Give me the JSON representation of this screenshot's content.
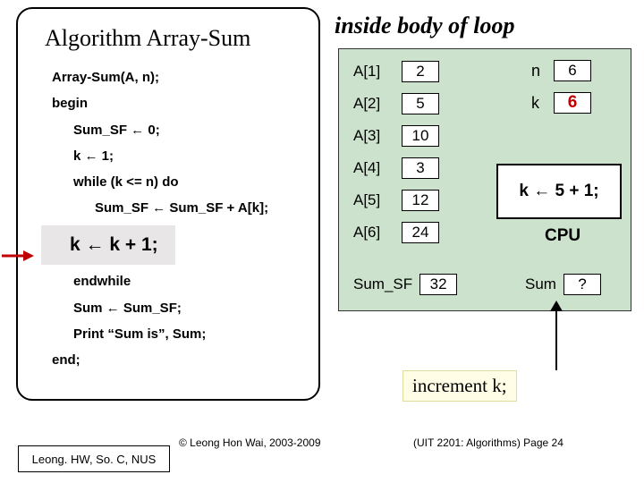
{
  "algo": {
    "title": "Algorithm Array-Sum",
    "l1": "Array-Sum(A, n);",
    "l2": "begin",
    "l3": "Sum_SF ← 0;",
    "l4": "k ← 1;",
    "l5": "while (k <= n) do",
    "l6": "Sum_SF ← Sum_SF + A[k];",
    "l7": "k ← k + 1;",
    "l8": "endwhile",
    "l9": "Sum ← Sum_SF;",
    "l10": "Print “Sum is”, Sum;",
    "l11": "end;"
  },
  "section_title": "inside body of loop",
  "state": {
    "a_labels": [
      "A[1]",
      "A[2]",
      "A[3]",
      "A[4]",
      "A[5]",
      "A[6]"
    ],
    "a_values": [
      "2",
      "5",
      "10",
      "3",
      "12",
      "24"
    ],
    "n_label": "n",
    "n_value": "6",
    "k_label": "k",
    "k_value": "6",
    "kbox": "k ← 5 + 1;",
    "cpu": "CPU",
    "sumsf_label": "Sum_SF",
    "sumsf_value": "32",
    "sum_label": "Sum",
    "sum_value": "?"
  },
  "increment_note": "increment k;",
  "copyright": "© Leong Hon Wai, 2003-2009",
  "page_tag": "(UIT 2201: Algorithms) Page 24",
  "footer": "Leong. HW, So. C, NUS"
}
